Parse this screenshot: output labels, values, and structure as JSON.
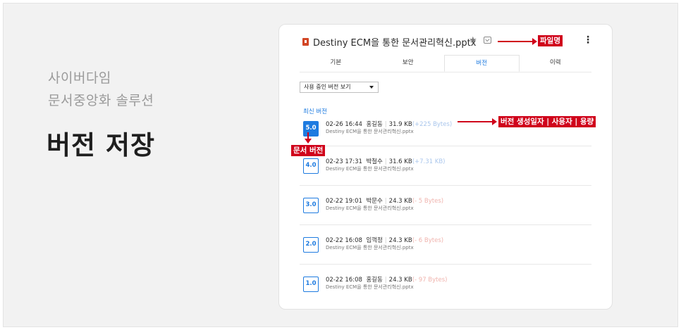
{
  "hero": {
    "brand_line1": "사이버다임",
    "brand_line2": "문서중앙화 솔루션",
    "headline": "버전 저장"
  },
  "file": {
    "name": "Destiny ECM을 통한 문서관리혁신.pptx",
    "icon": "pptx-file-icon"
  },
  "tabs": [
    {
      "label": "기본"
    },
    {
      "label": "보안"
    },
    {
      "label": "버전",
      "active": true
    },
    {
      "label": "이력"
    }
  ],
  "version_select": {
    "value": "사용 중인 버전 보기"
  },
  "latest_label": "최신 버전",
  "versions": [
    {
      "badge": "5.0",
      "datetime": "02-26 16:44",
      "user": "홍길동",
      "size": "31.9 KB",
      "delta": "(+225 Bytes)",
      "file": "Destiny ECM을 통한 문서관리혁신.pptx"
    },
    {
      "badge": "4.0",
      "datetime": "02-23 17:31",
      "user": "박철수",
      "size": "31.6 KB",
      "delta": "(+7.31 KB)",
      "file": "Destiny ECM을 통한 문서관리혁신.pptx"
    },
    {
      "badge": "3.0",
      "datetime": "02-22 19:01",
      "user": "박문수",
      "size": "24.3 KB",
      "delta": "(- 5 Bytes)",
      "file": "Destiny ECM을 통한 문서관리혁신.pptx"
    },
    {
      "badge": "2.0",
      "datetime": "02-22 16:08",
      "user": "임꺽정",
      "size": "24.3 KB",
      "delta": "(- 6 Bytes)",
      "file": "Destiny ECM을 통한 문서관리혁신.pptx"
    },
    {
      "badge": "1.0",
      "datetime": "02-22 16:08",
      "user": "홍길동",
      "size": "24.3 KB",
      "delta": "(- 97 Bytes)",
      "file": "Destiny ECM을 통한 문서관리혁신.pptx"
    }
  ],
  "callouts": {
    "filename": "파일명",
    "version_meta": "버전 생성일자 | 사용자 | 용량",
    "doc_version": "문서 버전"
  },
  "colors": {
    "accent": "#1e7be0",
    "callout": "#d0021b"
  }
}
